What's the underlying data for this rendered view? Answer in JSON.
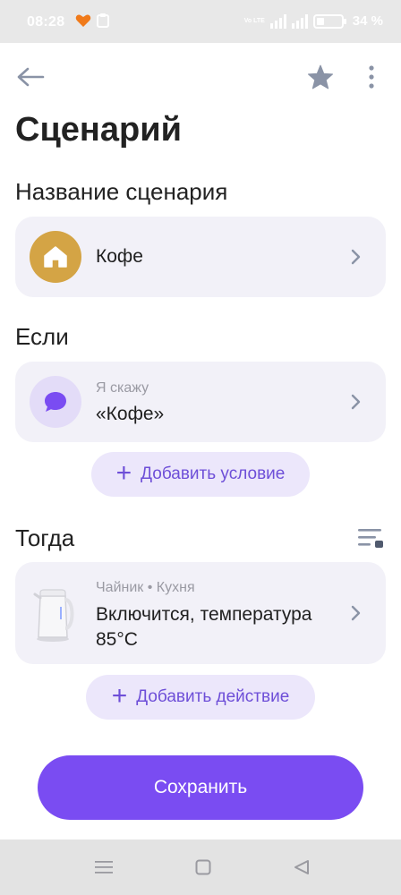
{
  "status_bar": {
    "time": "08:28",
    "network_label": "Vo LTE",
    "battery_percent": "34 %"
  },
  "header": {
    "title": "Сценарий"
  },
  "name_section": {
    "title": "Название сценария",
    "scenario_name": "Кофе",
    "icon": "home-icon"
  },
  "if_section": {
    "title": "Если",
    "condition_type": "Я скажу",
    "condition_value": "«Кофе»",
    "icon": "chat-bubble-icon",
    "add_button_label": "Добавить условие"
  },
  "then_section": {
    "title": "Тогда",
    "device": "Чайник",
    "separator": "•",
    "room": "Кухня",
    "action": "Включится, температура 85°C",
    "add_button_label": "Добавить действие"
  },
  "save_button_label": "Сохранить",
  "colors": {
    "accent": "#7a4cf2",
    "accent_light": "#ece7fb",
    "card_bg": "#f2f1f8",
    "home_avatar": "#d4a445"
  }
}
